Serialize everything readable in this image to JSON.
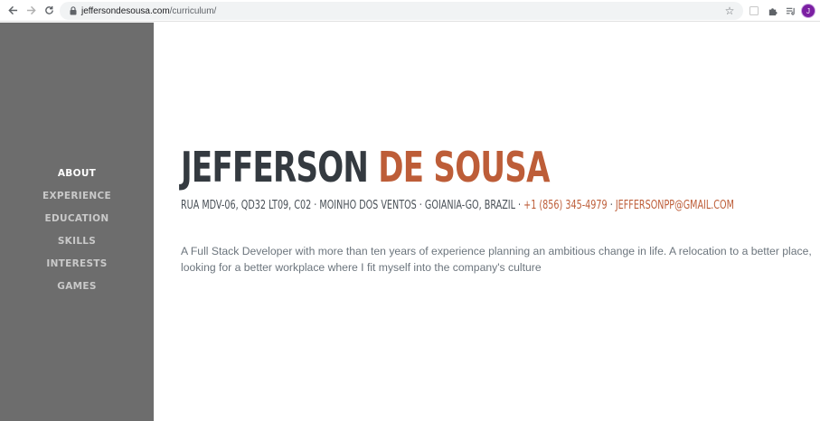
{
  "browser": {
    "url_domain": "jeffersondesousa.com",
    "url_path": "/curriculum/",
    "profile_initial": "J"
  },
  "sidebar": {
    "items": [
      {
        "label": "ABOUT",
        "active": true
      },
      {
        "label": "EXPERIENCE",
        "active": false
      },
      {
        "label": "EDUCATION",
        "active": false
      },
      {
        "label": "SKILLS",
        "active": false
      },
      {
        "label": "INTERESTS",
        "active": false
      },
      {
        "label": "GAMES",
        "active": false
      }
    ]
  },
  "about": {
    "first_name": "JEFFERSON",
    "last_name": "DE SOUSA",
    "address": "RUA MDV-06, QD32 LT09, C02 · MOINHO DOS VENTOS · GOIANIA-GO, BRAZIL · ",
    "phone": "+1 (856) 345-4979",
    "separator": " · ",
    "email": "JEFFERSONPP@GMAIL.COM",
    "description": "A Full Stack Developer with more than ten years of experience planning an ambitious change in life. A relocation to a better place, looking for a better workplace where I fit myself into the company's culture"
  },
  "colors": {
    "accent": "#bd5d38",
    "sidebar_bg": "#6d6d6d",
    "heading": "#343a40",
    "text_muted": "#6c757d"
  },
  "icons": {
    "back": "arrow-left-icon",
    "forward": "arrow-right-icon",
    "reload": "reload-icon",
    "lock": "lock-icon",
    "bookmark": "star-icon",
    "extension_blank": "extension-icon",
    "extensions": "puzzle-icon",
    "reading_list": "reading-list-icon"
  }
}
